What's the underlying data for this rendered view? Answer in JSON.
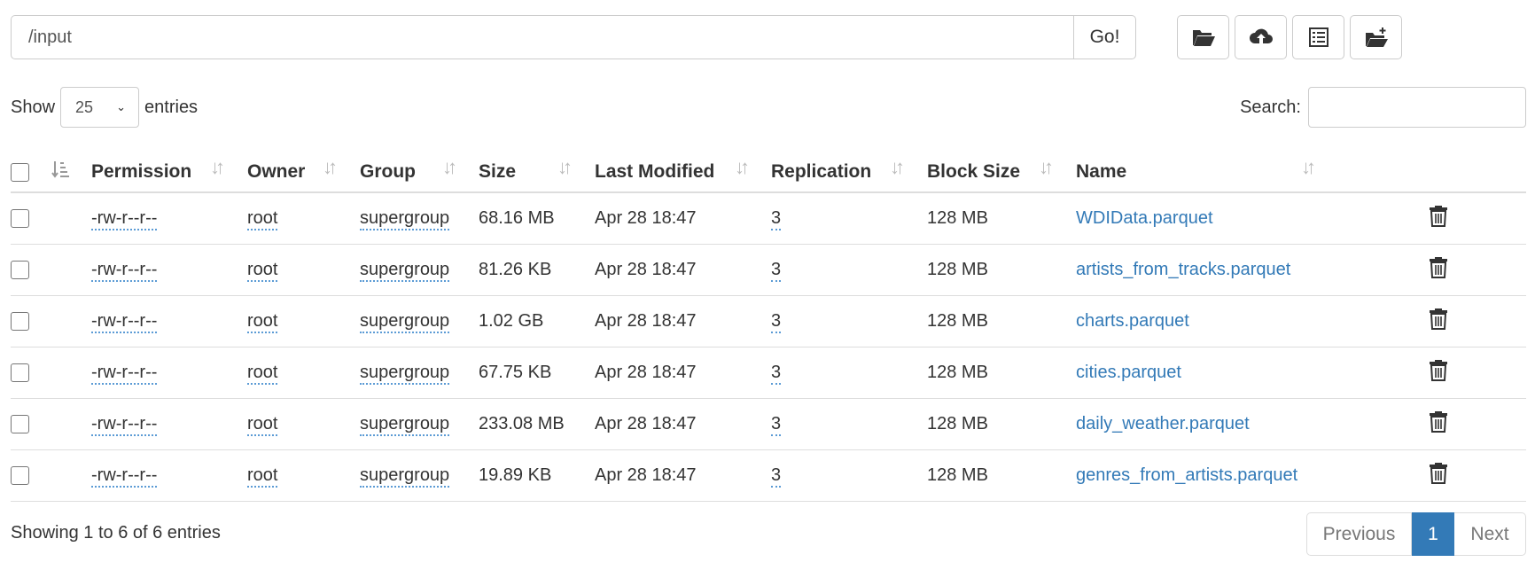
{
  "toolbar": {
    "path_value": "/input",
    "go_label": "Go!",
    "icons": [
      "folder-open-icon",
      "cloud-upload-icon",
      "list-icon",
      "create-folder-icon"
    ]
  },
  "entries": {
    "show_label": "Show",
    "selected": "25",
    "entries_label": "entries",
    "search_label": "Search:",
    "search_value": ""
  },
  "table": {
    "columns": [
      "Permission",
      "Owner",
      "Group",
      "Size",
      "Last Modified",
      "Replication",
      "Block Size",
      "Name"
    ],
    "rows": [
      {
        "permission": "-rw-r--r--",
        "owner": "root",
        "group": "supergroup",
        "size": "68.16 MB",
        "modified": "Apr 28 18:47",
        "replication": "3",
        "block_size": "128 MB",
        "name": "WDIData.parquet"
      },
      {
        "permission": "-rw-r--r--",
        "owner": "root",
        "group": "supergroup",
        "size": "81.26 KB",
        "modified": "Apr 28 18:47",
        "replication": "3",
        "block_size": "128 MB",
        "name": "artists_from_tracks.parquet"
      },
      {
        "permission": "-rw-r--r--",
        "owner": "root",
        "group": "supergroup",
        "size": "1.02 GB",
        "modified": "Apr 28 18:47",
        "replication": "3",
        "block_size": "128 MB",
        "name": "charts.parquet"
      },
      {
        "permission": "-rw-r--r--",
        "owner": "root",
        "group": "supergroup",
        "size": "67.75 KB",
        "modified": "Apr 28 18:47",
        "replication": "3",
        "block_size": "128 MB",
        "name": "cities.parquet"
      },
      {
        "permission": "-rw-r--r--",
        "owner": "root",
        "group": "supergroup",
        "size": "233.08 MB",
        "modified": "Apr 28 18:47",
        "replication": "3",
        "block_size": "128 MB",
        "name": "daily_weather.parquet"
      },
      {
        "permission": "-rw-r--r--",
        "owner": "root",
        "group": "supergroup",
        "size": "19.89 KB",
        "modified": "Apr 28 18:47",
        "replication": "3",
        "block_size": "128 MB",
        "name": "genres_from_artists.parquet"
      }
    ]
  },
  "footer": {
    "info": "Showing 1 to 6 of 6 entries",
    "prev_label": "Previous",
    "current_page": "1",
    "next_label": "Next"
  },
  "colors": {
    "link": "#337ab7",
    "active_page": "#337ab7"
  }
}
